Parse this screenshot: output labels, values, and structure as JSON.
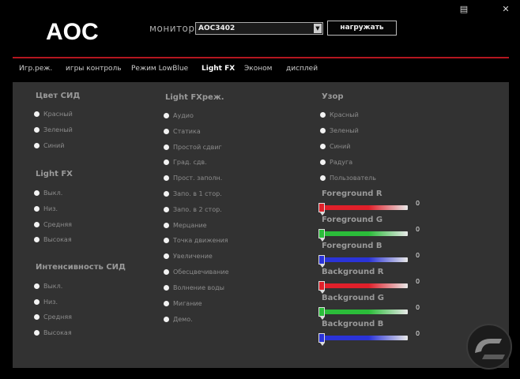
{
  "header": {
    "brand": "AOC",
    "monitor_label": "монитор",
    "monitor_value": "AOC3402",
    "load_label": "нагружать",
    "window_buttons": [
      {
        "icon": "chat-icon",
        "glyph": "▤"
      },
      {
        "icon": "close-icon",
        "glyph": "✕"
      }
    ]
  },
  "tabs": [
    {
      "label": "Игр.реж."
    },
    {
      "label": "игры контроль"
    },
    {
      "label": "Режим LowBlue"
    },
    {
      "label": "Light FX",
      "active": true
    },
    {
      "label": "Эконом"
    },
    {
      "label": "дисплей"
    }
  ],
  "led_color": {
    "title": "Цвет СИД",
    "options": [
      "Красный",
      "Зеленый",
      "Синий"
    ]
  },
  "light_fx": {
    "title": "Light FX",
    "options": [
      "Выкл.",
      "Низ.",
      "Средняя",
      "Высокая"
    ]
  },
  "led_intensity": {
    "title": "Интенсивность СИД",
    "options": [
      "Выкл.",
      "Низ.",
      "Средняя",
      "Высокая"
    ]
  },
  "light_fx_mode": {
    "title": "Light FXреж.",
    "options": [
      "Аудио",
      "Статика",
      "Простой сдвиг",
      "Град. сдв.",
      "Прост. заполн.",
      "Запо. в 1 стор.",
      "Запо. в 2 стор.",
      "Мерцание",
      "Точка движения",
      "Увеличение",
      "Обесцвечивание",
      "Волнение воды",
      "Мигание",
      "Демо."
    ]
  },
  "pattern": {
    "title": "Узор",
    "options": [
      "Красный",
      "Зеленый",
      "Синий",
      "Радуга",
      "Пользователь"
    ]
  },
  "sliders": [
    {
      "label": "Foreground R",
      "value": "0",
      "color": "#e0202a",
      "level": 0
    },
    {
      "label": "Foreground G",
      "value": "0",
      "color": "#2bbd3a",
      "level": 0
    },
    {
      "label": "Foreground B",
      "value": "0",
      "color": "#2a33d8",
      "level": 0
    },
    {
      "label": "Background R",
      "value": "0",
      "color": "#e0202a",
      "level": 0
    },
    {
      "label": "Background G",
      "value": "0",
      "color": "#2bbd3a",
      "level": 0
    },
    {
      "label": "Background B",
      "value": "0",
      "color": "#2a33d8",
      "level": 0
    }
  ]
}
